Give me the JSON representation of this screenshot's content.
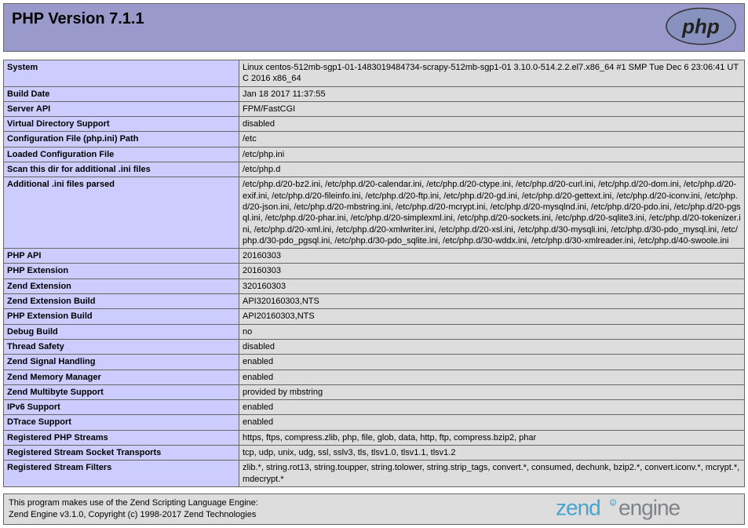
{
  "header": {
    "title": "PHP Version 7.1.1"
  },
  "rows": [
    {
      "label": "System",
      "value": "Linux centos-512mb-sgp1-01-1483019484734-scrapy-512mb-sgp1-01 3.10.0-514.2.2.el7.x86_64 #1 SMP Tue Dec 6 23:06:41 UTC 2016 x86_64"
    },
    {
      "label": "Build Date",
      "value": "Jan 18 2017 11:37:55"
    },
    {
      "label": "Server API",
      "value": "FPM/FastCGI"
    },
    {
      "label": "Virtual Directory Support",
      "value": "disabled"
    },
    {
      "label": "Configuration File (php.ini) Path",
      "value": "/etc"
    },
    {
      "label": "Loaded Configuration File",
      "value": "/etc/php.ini"
    },
    {
      "label": "Scan this dir for additional .ini files",
      "value": "/etc/php.d"
    },
    {
      "label": "Additional .ini files parsed",
      "value": "/etc/php.d/20-bz2.ini, /etc/php.d/20-calendar.ini, /etc/php.d/20-ctype.ini, /etc/php.d/20-curl.ini, /etc/php.d/20-dom.ini, /etc/php.d/20-exif.ini, /etc/php.d/20-fileinfo.ini, /etc/php.d/20-ftp.ini, /etc/php.d/20-gd.ini, /etc/php.d/20-gettext.ini, /etc/php.d/20-iconv.ini, /etc/php.d/20-json.ini, /etc/php.d/20-mbstring.ini, /etc/php.d/20-mcrypt.ini, /etc/php.d/20-mysqlnd.ini, /etc/php.d/20-pdo.ini, /etc/php.d/20-pgsql.ini, /etc/php.d/20-phar.ini, /etc/php.d/20-simplexml.ini, /etc/php.d/20-sockets.ini, /etc/php.d/20-sqlite3.ini, /etc/php.d/20-tokenizer.ini, /etc/php.d/20-xml.ini, /etc/php.d/20-xmlwriter.ini, /etc/php.d/20-xsl.ini, /etc/php.d/30-mysqli.ini, /etc/php.d/30-pdo_mysql.ini, /etc/php.d/30-pdo_pgsql.ini, /etc/php.d/30-pdo_sqlite.ini, /etc/php.d/30-wddx.ini, /etc/php.d/30-xmlreader.ini, /etc/php.d/40-swoole.ini"
    },
    {
      "label": "PHP API",
      "value": "20160303"
    },
    {
      "label": "PHP Extension",
      "value": "20160303"
    },
    {
      "label": "Zend Extension",
      "value": "320160303"
    },
    {
      "label": "Zend Extension Build",
      "value": "API320160303,NTS"
    },
    {
      "label": "PHP Extension Build",
      "value": "API20160303,NTS"
    },
    {
      "label": "Debug Build",
      "value": "no"
    },
    {
      "label": "Thread Safety",
      "value": "disabled"
    },
    {
      "label": "Zend Signal Handling",
      "value": "enabled"
    },
    {
      "label": "Zend Memory Manager",
      "value": "enabled"
    },
    {
      "label": "Zend Multibyte Support",
      "value": "provided by mbstring"
    },
    {
      "label": "IPv6 Support",
      "value": "enabled"
    },
    {
      "label": "DTrace Support",
      "value": "enabled"
    },
    {
      "label": "Registered PHP Streams",
      "value": "https, ftps, compress.zlib, php, file, glob, data, http, ftp, compress.bzip2, phar"
    },
    {
      "label": "Registered Stream Socket Transports",
      "value": "tcp, udp, unix, udg, ssl, sslv3, tls, tlsv1.0, tlsv1.1, tlsv1.2"
    },
    {
      "label": "Registered Stream Filters",
      "value": "zlib.*, string.rot13, string.toupper, string.tolower, string.strip_tags, convert.*, consumed, dechunk, bzip2.*, convert.iconv.*, mcrypt.*, mdecrypt.*"
    }
  ],
  "zend": {
    "line1": "This program makes use of the Zend Scripting Language Engine:",
    "line2": "Zend Engine v3.1.0, Copyright (c) 1998-2017 Zend Technologies"
  }
}
